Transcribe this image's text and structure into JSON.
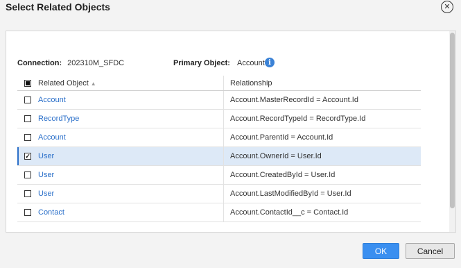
{
  "dialog": {
    "title": "Select Related Objects",
    "close_icon": "close-icon"
  },
  "connection": {
    "label": "Connection:",
    "value": "202310M_SFDC"
  },
  "primary_object": {
    "label": "Primary Object:",
    "value": "Account",
    "icon": "info-icon"
  },
  "table": {
    "columns": [
      "Related Object",
      "Relationship"
    ],
    "sort_icon": "sort-ascending-icon",
    "header_checkbox_state": "partial",
    "rows": [
      {
        "object": "Account",
        "relationship": "Account.MasterRecordId = Account.Id",
        "checked": false
      },
      {
        "object": "RecordType",
        "relationship": "Account.RecordTypeId = RecordType.Id",
        "checked": false
      },
      {
        "object": "Account",
        "relationship": "Account.ParentId = Account.Id",
        "checked": false
      },
      {
        "object": "User",
        "relationship": "Account.OwnerId = User.Id",
        "checked": true
      },
      {
        "object": "User",
        "relationship": "Account.CreatedById = User.Id",
        "checked": false
      },
      {
        "object": "User",
        "relationship": "Account.LastModifiedById = User.Id",
        "checked": false
      },
      {
        "object": "Contact",
        "relationship": "Account.ContactId__c = Contact.Id",
        "checked": false
      }
    ]
  },
  "buttons": {
    "ok": "OK",
    "cancel": "Cancel"
  },
  "colors": {
    "link": "#2a6fc9",
    "selected_row": "#dde9f7",
    "ok_button": "#3a8ff0"
  }
}
